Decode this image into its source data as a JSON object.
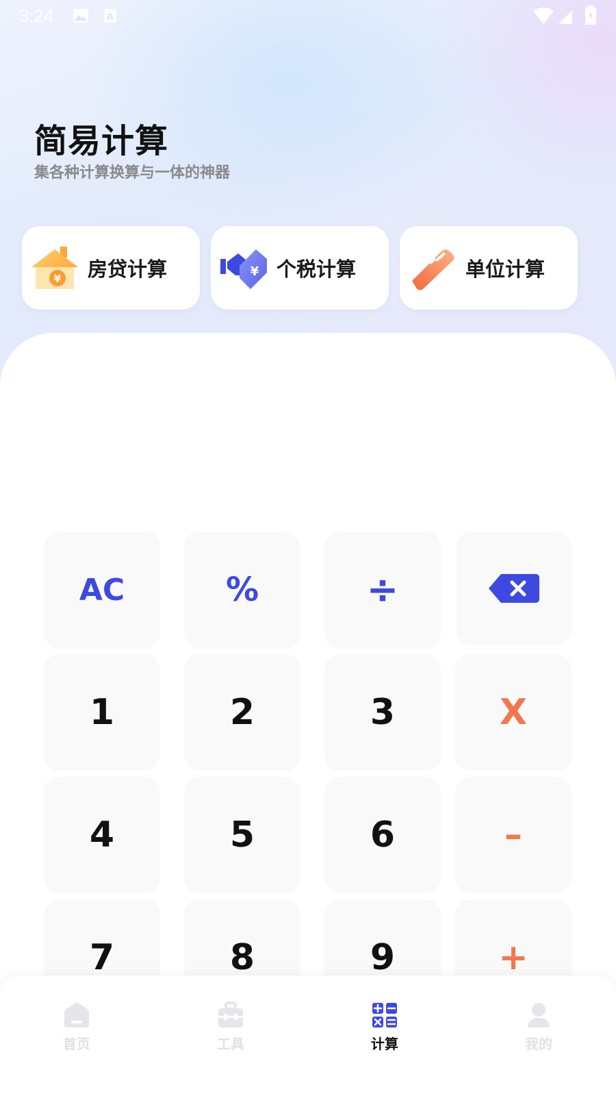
{
  "status_bar": {
    "time": "3:24",
    "icons": [
      "image-icon",
      "font-icon",
      "wifi-icon",
      "signal-icon",
      "battery-icon"
    ]
  },
  "header": {
    "title": "简易计算",
    "subtitle": "集各种计算换算与一体的神器"
  },
  "features": [
    {
      "label": "房贷计算",
      "icon": "house-yuan-icon"
    },
    {
      "label": "个税计算",
      "icon": "tax-tag-icon"
    },
    {
      "label": "单位计算",
      "icon": "ruler-icon"
    }
  ],
  "calculator": {
    "display": "",
    "keys": {
      "ac": "AC",
      "percent": "%",
      "divide": "÷",
      "backspace_icon": "backspace-icon",
      "one": "1",
      "two": "2",
      "three": "3",
      "multiply": "X",
      "four": "4",
      "five": "5",
      "six": "6",
      "minus": "–",
      "seven": "7",
      "eight": "8",
      "nine": "9",
      "plus": "+"
    }
  },
  "tabs": [
    {
      "label": "首页",
      "icon": "home-icon",
      "active": false
    },
    {
      "label": "工具",
      "icon": "toolbox-icon",
      "active": false
    },
    {
      "label": "计算",
      "icon": "calculator-icon",
      "active": true
    },
    {
      "label": "我的",
      "icon": "user-icon",
      "active": false
    }
  ],
  "colors": {
    "accent_blue": "#3d49e0",
    "operator_orange": "#f2774d",
    "tab_inactive": "#e1e1e6",
    "key_background": "#f9f9fa"
  }
}
